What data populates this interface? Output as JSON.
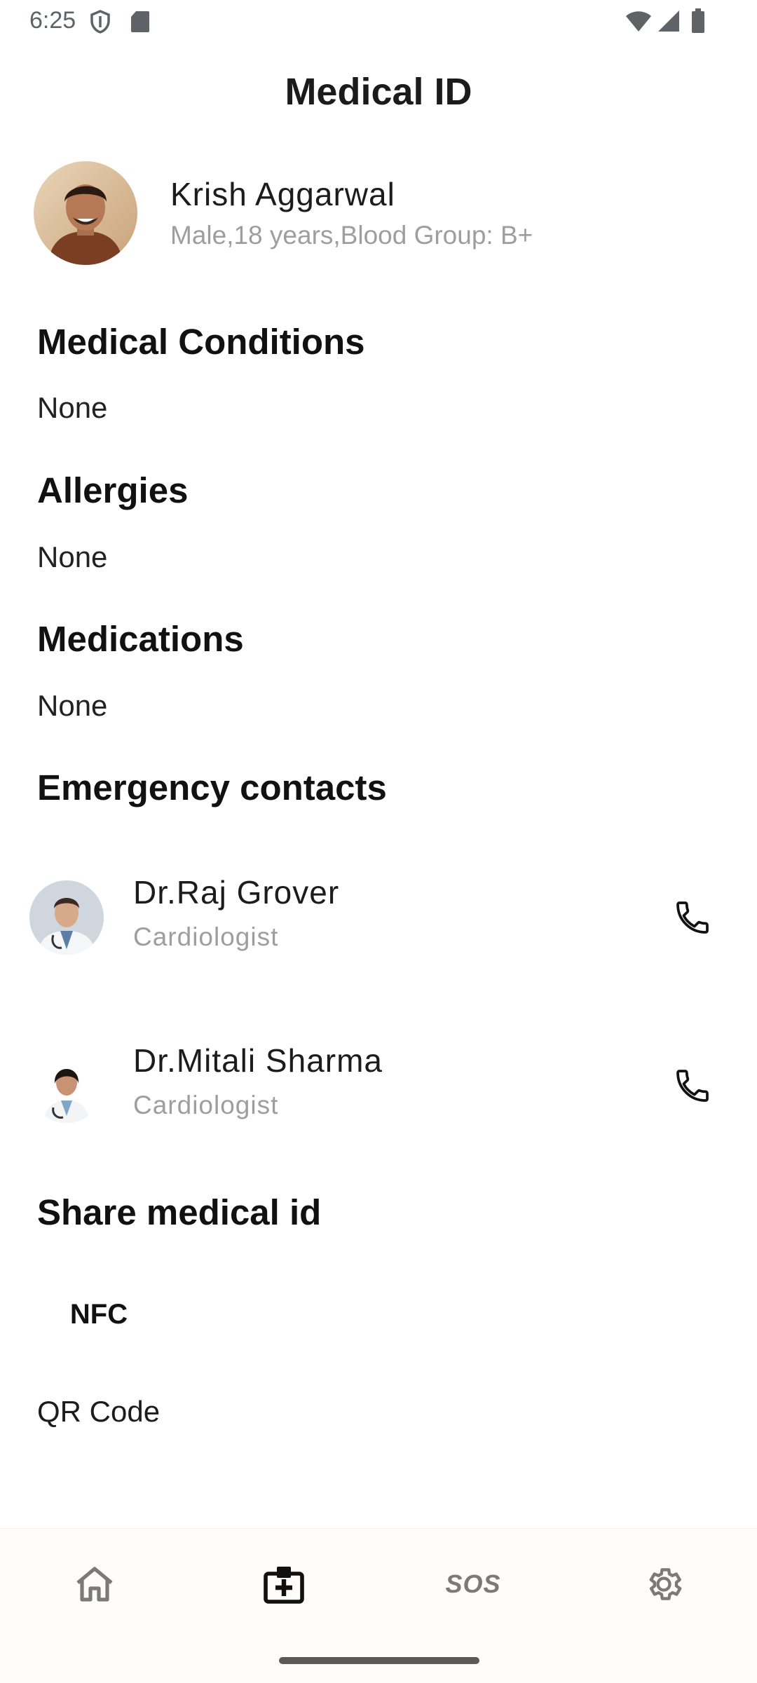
{
  "status_bar": {
    "time": "6:25"
  },
  "header": {
    "title": "Medical ID"
  },
  "profile": {
    "name": "Krish Aggarwal",
    "details": "Male,18 years,Blood Group: B+"
  },
  "sections": {
    "medical_conditions": {
      "title": "Medical Conditions",
      "value": "None"
    },
    "allergies": {
      "title": "Allergies",
      "value": "None"
    },
    "medications": {
      "title": "Medications",
      "value": "None"
    },
    "emergency_contacts": {
      "title": "Emergency contacts"
    },
    "share": {
      "title": "Share medical id"
    }
  },
  "contacts": [
    {
      "name": "Dr.Raj Grover",
      "role": "Cardiologist"
    },
    {
      "name": "Dr.Mitali Sharma",
      "role": "Cardiologist"
    }
  ],
  "share_options": {
    "nfc": "NFC",
    "qr": "QR Code"
  },
  "bottom_nav": {
    "items": [
      {
        "icon": "home-icon"
      },
      {
        "icon": "medical-id-icon",
        "selected": true
      },
      {
        "icon": "sos-icon",
        "label": "SOS"
      },
      {
        "icon": "gear-icon"
      }
    ]
  },
  "colors": {
    "primary_text": "#1c1c1c",
    "secondary_text": "#9e9e9e",
    "nav_bg": "#fffcfb"
  }
}
